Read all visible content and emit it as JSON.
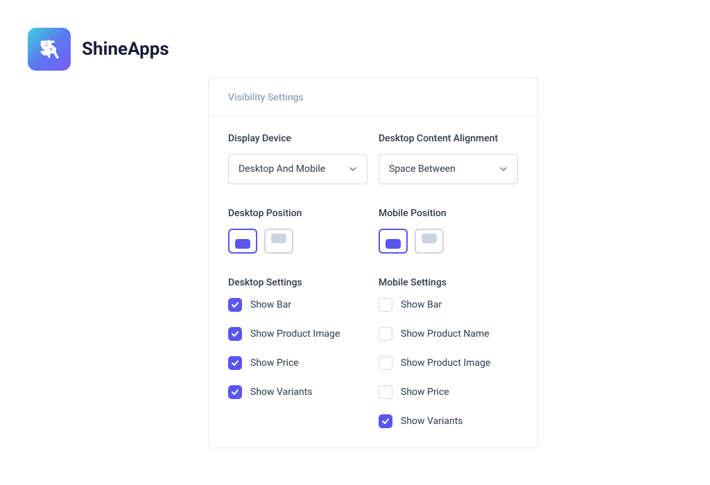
{
  "brand": {
    "name": "ShineApps"
  },
  "panel": {
    "title": "Visibility Settings",
    "display_device": {
      "label": "Display Device",
      "value": "Desktop And Mobile"
    },
    "content_alignment": {
      "label": "Desktop Content Alignment",
      "value": "Space Between"
    },
    "desktop_position": {
      "label": "Desktop Position"
    },
    "mobile_position": {
      "label": "Mobile Position"
    },
    "desktop_settings": {
      "label": "Desktop Settings",
      "items": [
        {
          "label": "Show Bar",
          "checked": true
        },
        {
          "label": "Show Product Image",
          "checked": true
        },
        {
          "label": "Show Price",
          "checked": true
        },
        {
          "label": "Show Variants",
          "checked": true
        }
      ]
    },
    "mobile_settings": {
      "label": "Mobile Settings",
      "items": [
        {
          "label": "Show Bar",
          "checked": false
        },
        {
          "label": "Show Product Name",
          "checked": false
        },
        {
          "label": "Show Product Image",
          "checked": false
        },
        {
          "label": "Show Price",
          "checked": false
        },
        {
          "label": "Show Variants",
          "checked": true
        }
      ]
    }
  }
}
